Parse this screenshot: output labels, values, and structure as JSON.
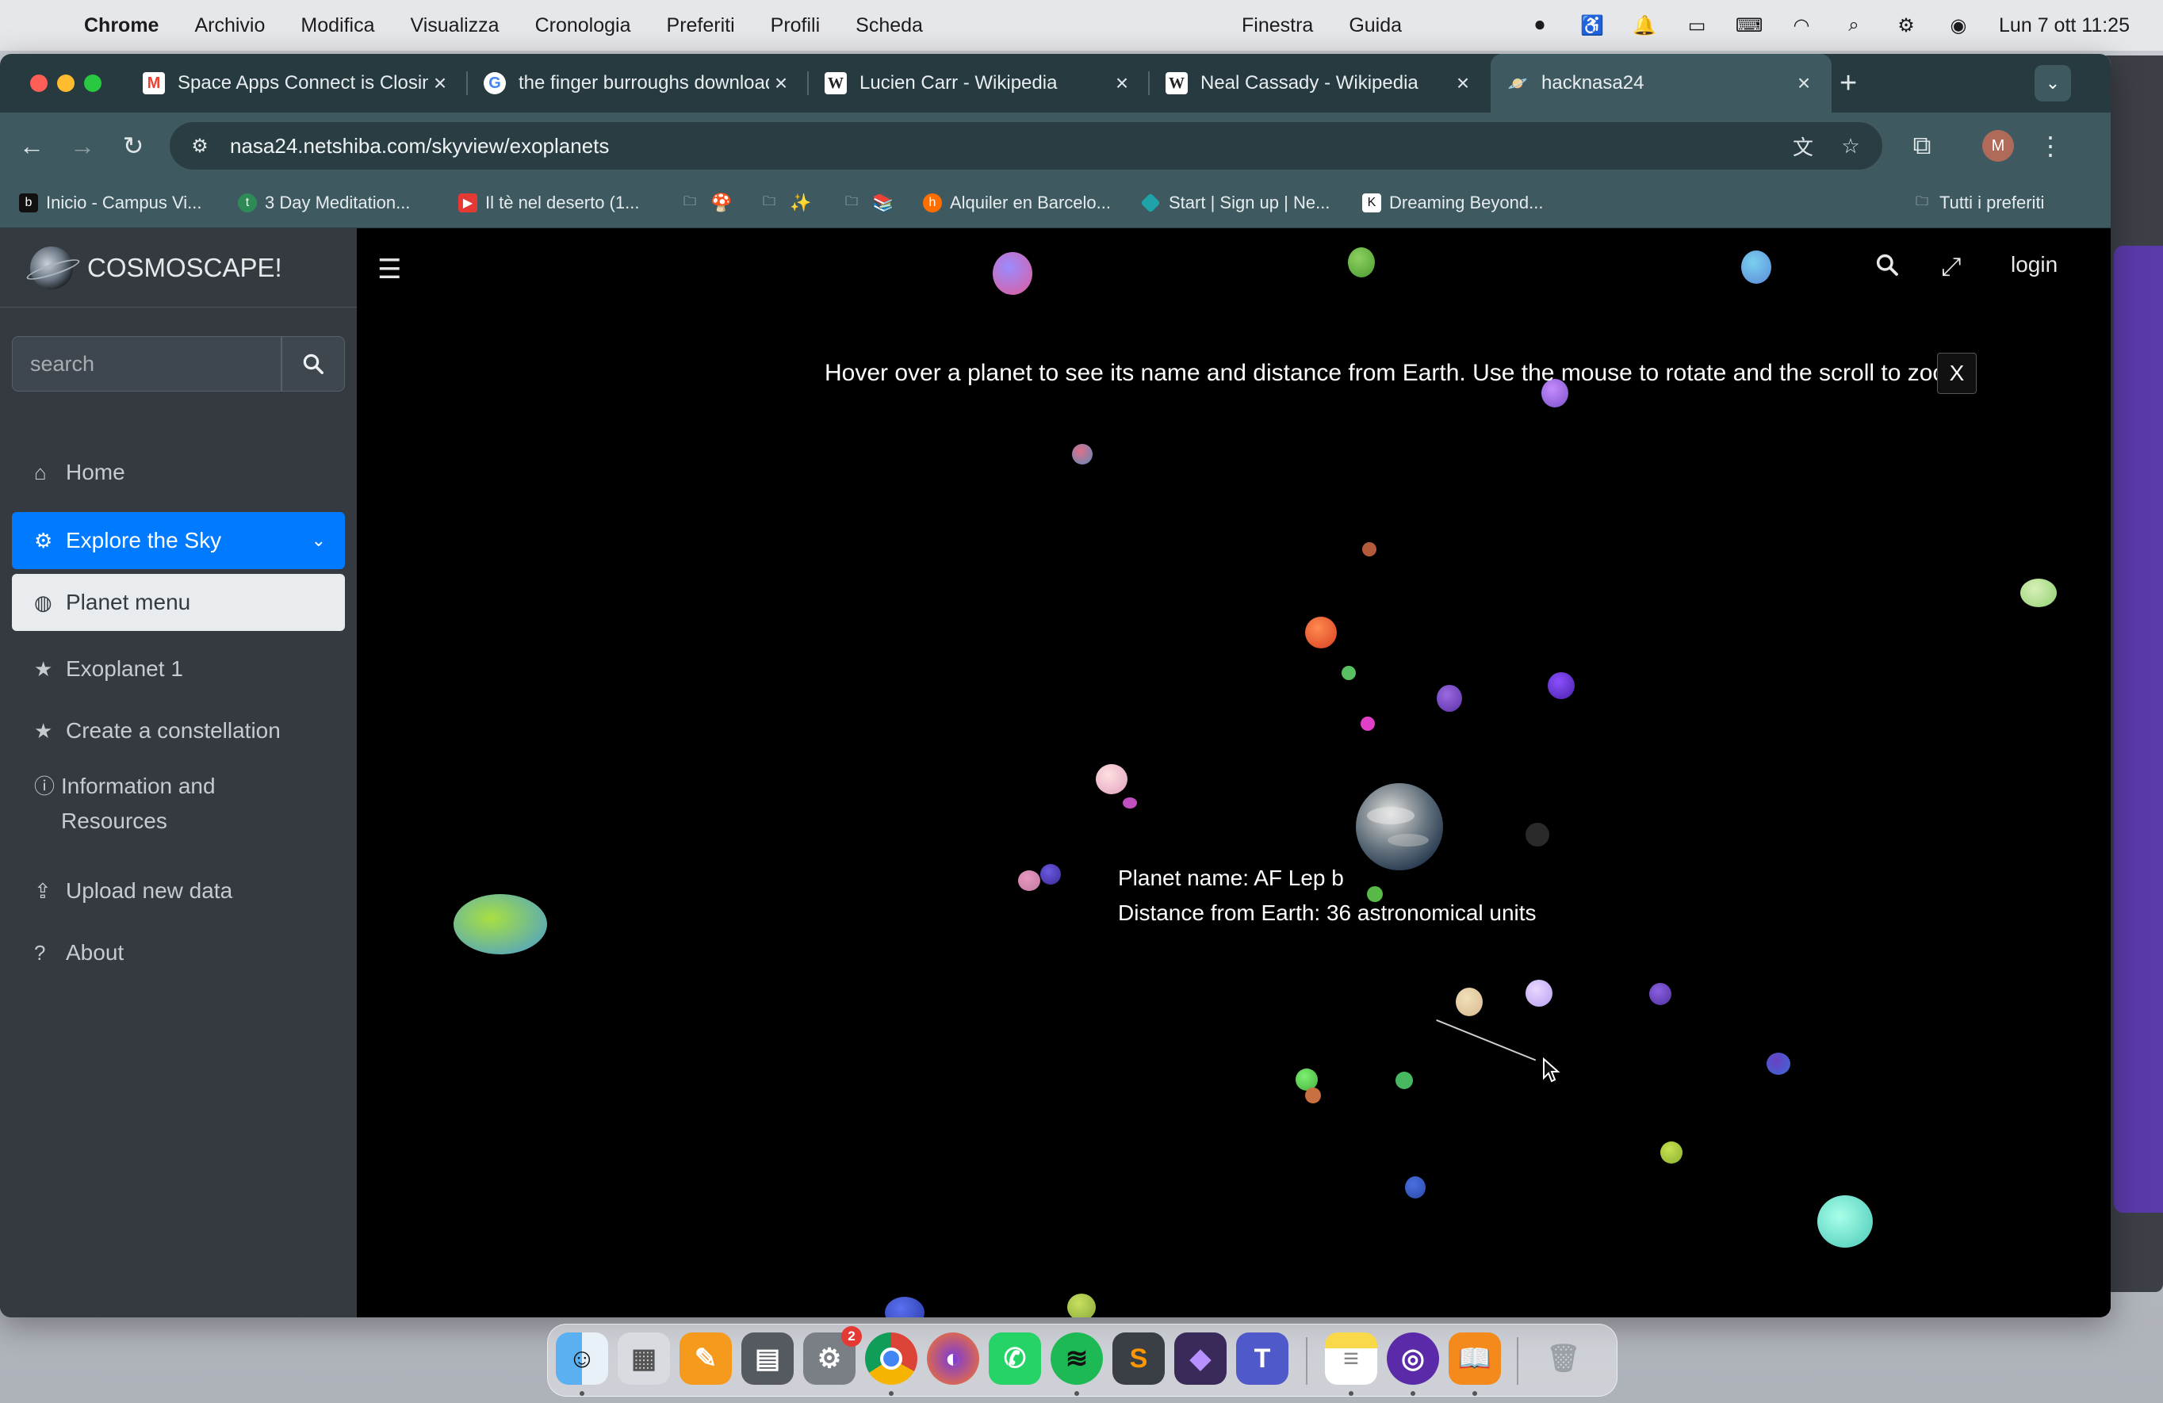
{
  "menubar": {
    "app": "Chrome",
    "items": [
      "Archivio",
      "Modifica",
      "Visualizza",
      "Cronologia",
      "Preferiti",
      "Profili",
      "Scheda"
    ],
    "right_items": [
      "Finestra",
      "Guida"
    ],
    "clock": "Lun 7 ott  11:25"
  },
  "browser": {
    "tabs": [
      {
        "title": "Space Apps Connect is Closing",
        "favicon": "gmail-icon"
      },
      {
        "title": "the finger burroughs download",
        "favicon": "google-icon"
      },
      {
        "title": "Lucien Carr - Wikipedia",
        "favicon": "wikipedia-icon"
      },
      {
        "title": "Neal Cassady - Wikipedia",
        "favicon": "wikipedia-icon"
      },
      {
        "title": "hacknasa24",
        "favicon": "site-icon"
      }
    ],
    "url": "nasa24.netshiba.com/skyview/exoplanets",
    "profile_initial": "M",
    "bookmarks": [
      {
        "label": "Inicio - Campus Vi..."
      },
      {
        "label": "3 Day Meditation..."
      },
      {
        "label": "Il tè nel deserto (1..."
      },
      {
        "label": ""
      },
      {
        "label": ""
      },
      {
        "label": ""
      },
      {
        "label": "Alquiler en Barcelo..."
      },
      {
        "label": "Start | Sign up | Ne..."
      },
      {
        "label": "Dreaming Beyond..."
      }
    ],
    "all_bookmarks": "Tutti i preferiti"
  },
  "app": {
    "brand": "COSMOSCAPE!",
    "search_placeholder": "search",
    "nav": [
      {
        "label": "Home",
        "icon": "home-icon"
      },
      {
        "label": "Explore the Sky",
        "icon": "gear-icon"
      },
      {
        "label": "Planet menu",
        "icon": "globe-icon"
      },
      {
        "label": "Exoplanet 1",
        "icon": "star-icon"
      },
      {
        "label": "Create a constellation",
        "icon": "star-icon"
      },
      {
        "label": "Information and Resources",
        "icon": "info-icon"
      },
      {
        "label": "Upload new data",
        "icon": "upload-icon"
      },
      {
        "label": "About",
        "icon": "question-icon"
      }
    ],
    "login": "login",
    "hint": "Hover over a planet to see its name and distance from Earth. Use the mouse to rotate and the scroll to zoom.",
    "hint_close": "X",
    "tooltip": {
      "name_line": "Planet name: AF Lep b",
      "distance_line": "Distance from Earth: 36 astronomical units"
    }
  },
  "dock": {
    "apps": [
      "Finder",
      "Launchpad",
      "Pages",
      "Calculator",
      "System Settings",
      "Chrome",
      "Firefox",
      "WhatsApp",
      "Spotify",
      "Sublime Text",
      "Obsidian",
      "Teams",
      "Notes",
      "Tor",
      "Books",
      "Trash"
    ],
    "settings_badge": "2"
  },
  "colors": {
    "sidebar_bg": "#343a40",
    "active_nav": "#007bff",
    "canvas_bg": "#000000"
  }
}
